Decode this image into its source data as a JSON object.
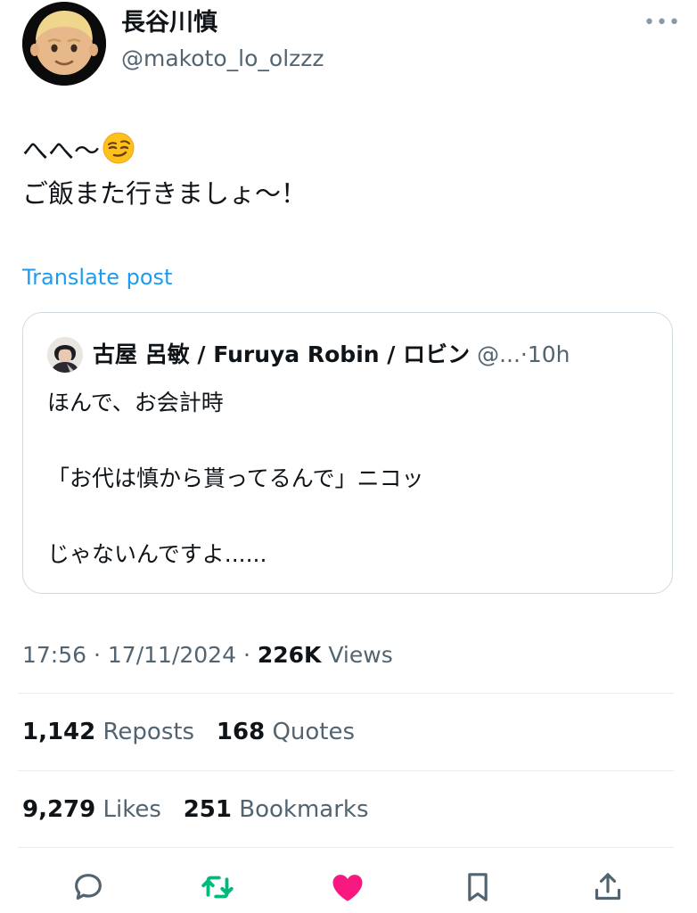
{
  "author": {
    "display_name": "長谷川慎",
    "handle": "@makoto_lo_olzzz"
  },
  "more_label": "•••",
  "tweet": {
    "line1": "へへ〜",
    "line1_emoji": "smirking-face-emoji",
    "line2": "ご飯また行きましょ〜！"
  },
  "translate_label": "Translate post",
  "quote": {
    "name": "古屋 呂敏 / Furuya Robin / ロビン",
    "handle": "@...",
    "separator": "·",
    "time": "10h",
    "lines": [
      "ほんで、お会計時",
      "「お代は慎から貰ってるんで」ニコッ",
      "じゃないんですよ......"
    ]
  },
  "meta": {
    "time": "17:56",
    "sep1": "·",
    "date": "17/11/2024",
    "sep2": "·",
    "views_count": "226K",
    "views_label": "Views"
  },
  "stats": {
    "reposts_count": "1,142",
    "reposts_label": "Reposts",
    "quotes_count": "168",
    "quotes_label": "Quotes",
    "likes_count": "9,279",
    "likes_label": "Likes",
    "bookmarks_count": "251",
    "bookmarks_label": "Bookmarks"
  },
  "actions": [
    "reply-icon",
    "retweet-icon",
    "like-icon",
    "bookmark-icon",
    "share-icon"
  ],
  "colors": {
    "link": "#1d9bf0",
    "retweet": "#00ba7c",
    "like": "#f91880",
    "secondary_text": "#536471",
    "icon": "#536471"
  }
}
